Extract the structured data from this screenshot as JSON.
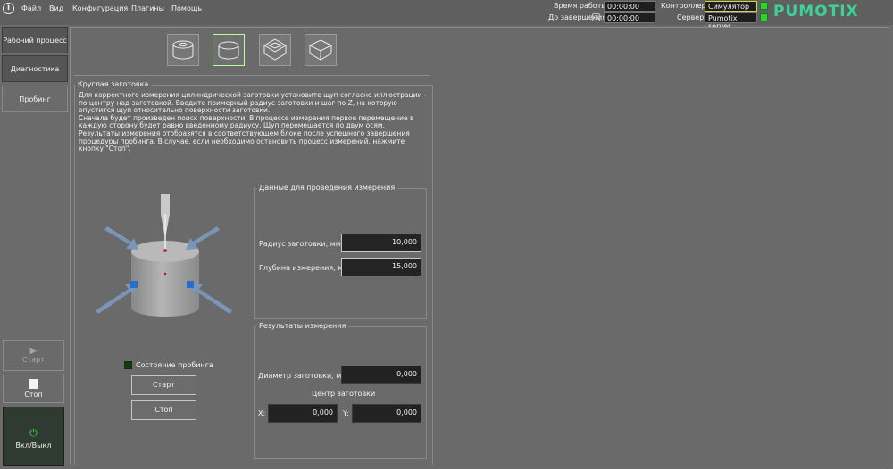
{
  "menu": [
    "Файл",
    "Вид",
    "Конфигурация",
    "Плагины",
    "Помощь"
  ],
  "status": {
    "work_time_label": "Время работы",
    "work_time_value": "00:00:00",
    "remaining_label": "До завершения",
    "remaining_value": "00:00:00",
    "controller_label": "Контроллер",
    "controller_value": "Симулятор",
    "server_label": "Сервер",
    "server_value": "Pumotix server",
    "led_color": "#2bd42b"
  },
  "logo": "PUMOTIX",
  "sidebar": {
    "tabs": [
      "Рабочий процесс",
      "Диагностика",
      "Пробинг"
    ],
    "start_label": "Старт",
    "stop_label": "Стоп",
    "power_label": "Вкл/Выкл"
  },
  "probing": {
    "section_title": "Круглая заготовка",
    "description": "Для корректного измерения цилиндрической заготовки установите щуп согласно иллюстрации - по центру над заготовкой. Введите примерный радиус заготовки и шаг по Z, на которую опустится щуп относительно поверхности заготовки.\nСначала будет произведен поиск поверхности. В процессе измерения первое перемещение в каждую сторону будет равно введенному радиусу. Щуп перемещается по двум осям.\nРезультаты измерения отобразятся в соответствующем блоке после успешного завершения процедуры пробинга. В случае, если необходимо остановить процесс измерений, нажмите кнопку \"Стоп\".",
    "params": {
      "title": "Данные для проведения измерения",
      "radius_label": "Радиус заготовки, мм",
      "radius_value": "10,000",
      "depth_label": "Глубина измерения, мм",
      "depth_value": "15,000"
    },
    "results": {
      "title": "Результаты измерения",
      "diameter_label": "Диаметр заготовки, мм",
      "diameter_value": "0,000",
      "center_label": "Центр заготовки",
      "x_label": "X:",
      "x_value": "0,000",
      "y_label": "Y:",
      "y_value": "0,000"
    },
    "state_label": "Состояние пробинга",
    "start_button": "Старт",
    "stop_button": "Стоп"
  }
}
